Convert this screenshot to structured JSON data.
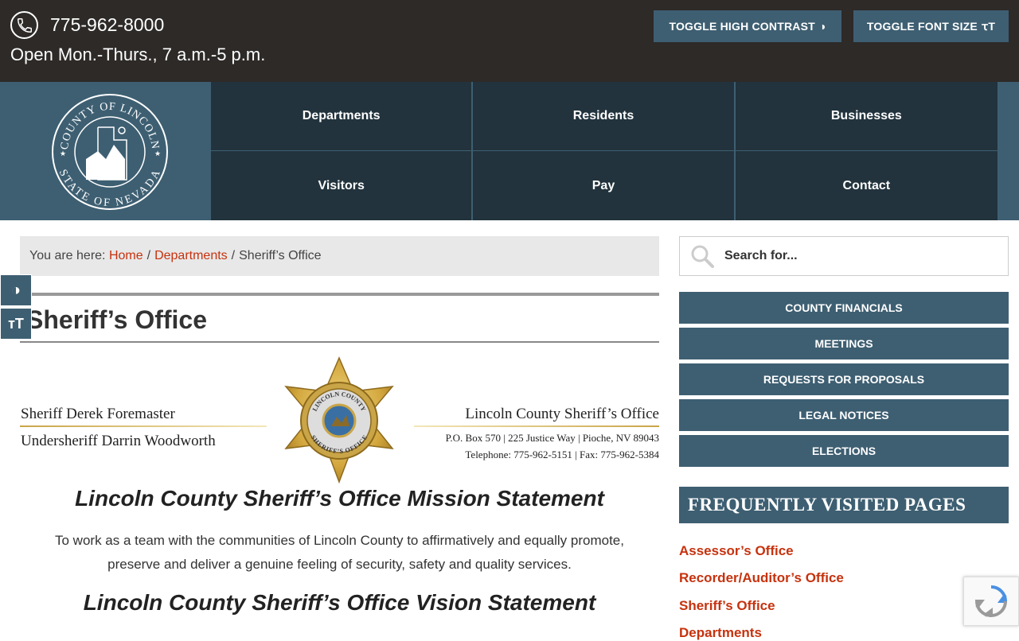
{
  "topbar": {
    "phone": "775-962-8000",
    "hours": "Open Mon.-Thurs., 7 a.m.-5 p.m.",
    "contrast_btn": "TOGGLE HIGH CONTRAST",
    "font_btn": "TOGGLE FONT SIZE"
  },
  "logo": {
    "top_text": "COUNTY OF LINCOLN",
    "bottom_text": "STATE OF NEVADA"
  },
  "nav": {
    "items": [
      "Departments",
      "Residents",
      "Businesses",
      "Visitors",
      "Pay",
      "Contact"
    ]
  },
  "breadcrumb": {
    "prefix": "You are here:",
    "home": "Home",
    "departments": "Departments",
    "sep": "/",
    "current": "Sheriff’s Office"
  },
  "page": {
    "title": "Sheriff’s Office"
  },
  "banner": {
    "sheriff": "Sheriff Derek Foremaster",
    "undersheriff": "Undersheriff Darrin Woodworth",
    "office": "Lincoln County Sheriff’s Office",
    "address": "P.O. Box 570 | 225 Justice Way | Pioche, NV 89043",
    "phones": "Telephone: 775-962-5151 | Fax: 775-962-5384",
    "badge_top": "LINCOLN COUNTY",
    "badge_bottom": "SHERIFF’S OFFICE"
  },
  "content": {
    "mission_heading": "Lincoln County Sheriff’s Office Mission Statement",
    "mission_line1": "To work as a team with the communities of Lincoln County to affirmatively and equally promote,",
    "mission_line2": "preserve and deliver a genuine feeling of security, safety and quality services.",
    "vision_heading": "Lincoln County Sheriff’s Office Vision Statement"
  },
  "sidebar": {
    "search_placeholder": "Search for...",
    "buttons": [
      "COUNTY FINANCIALS",
      "MEETINGS",
      "REQUESTS FOR PROPOSALS",
      "LEGAL NOTICES",
      "ELECTIONS"
    ],
    "fvp_heading": "FREQUENTLY VISITED PAGES",
    "links": [
      "Assessor’s Office",
      "Recorder/Auditor’s Office",
      "Sheriff’s Office",
      "Departments"
    ]
  },
  "colors": {
    "topbar": "#2d2a28",
    "brand": "#3e5f72",
    "nav": "#22333d",
    "link": "#c6320e"
  }
}
